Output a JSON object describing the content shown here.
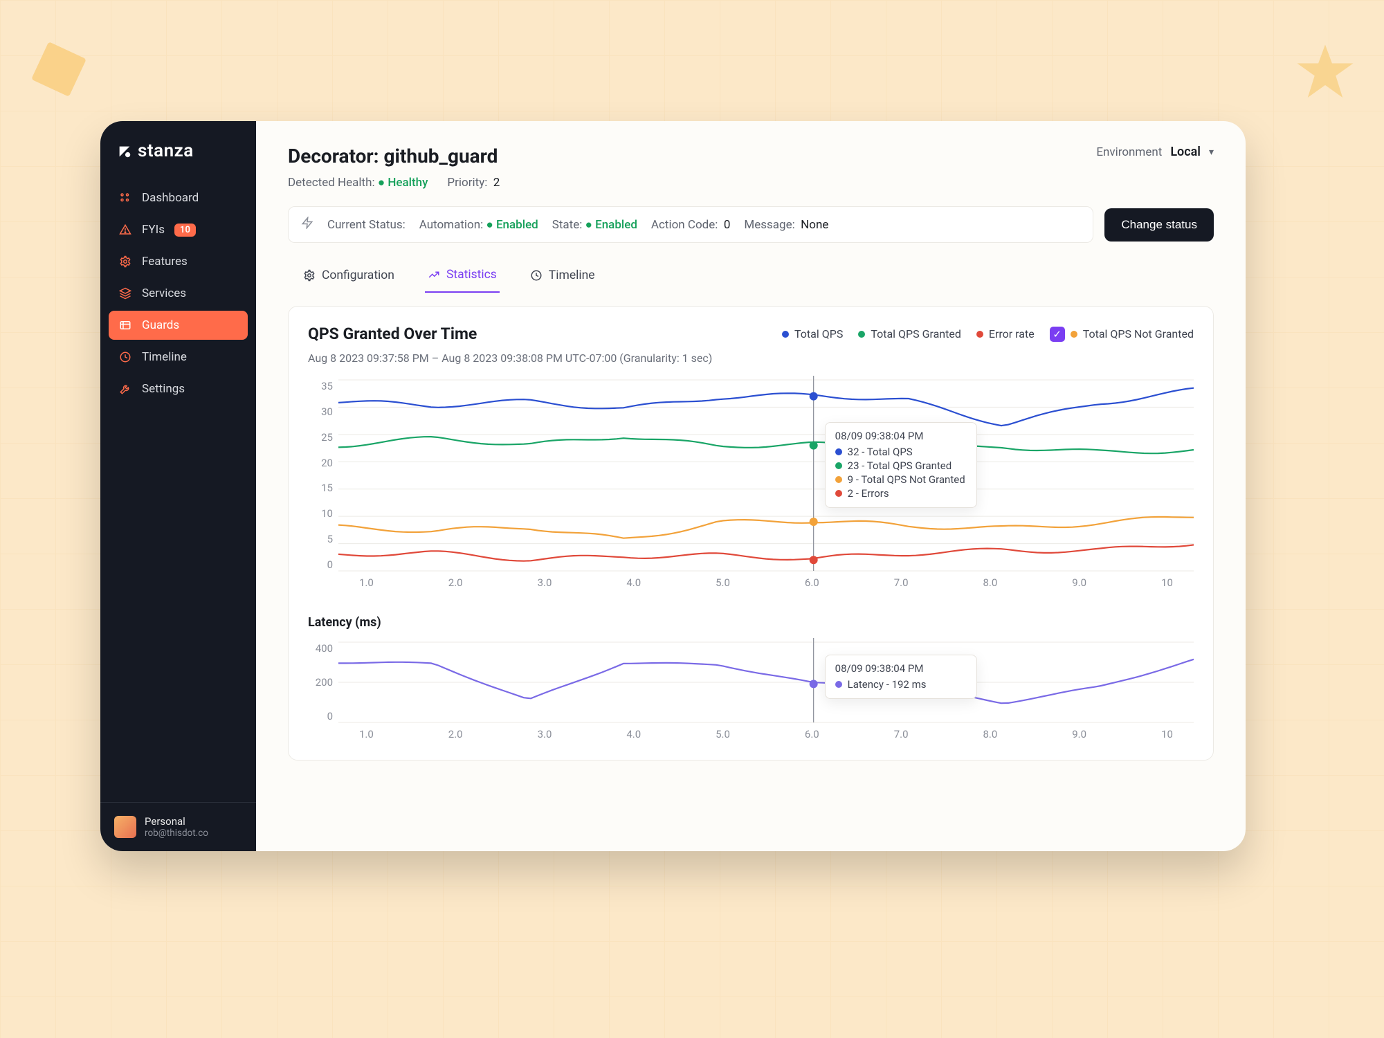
{
  "brand": "stanza",
  "sidebar": {
    "items": [
      {
        "icon": "grid-icon",
        "label": "Dashboard"
      },
      {
        "icon": "alert-icon",
        "label": "FYIs",
        "badge": "10"
      },
      {
        "icon": "gear-icon",
        "label": "Features"
      },
      {
        "icon": "layers-icon",
        "label": "Services"
      },
      {
        "icon": "shield-icon",
        "label": "Guards"
      },
      {
        "icon": "clock-icon",
        "label": "Timeline"
      },
      {
        "icon": "wrench-icon",
        "label": "Settings"
      }
    ],
    "active_index": 4,
    "account": {
      "name": "Personal",
      "email": "rob@thisdot.co"
    }
  },
  "header": {
    "title": "Decorator: github_guard",
    "detected_health_label": "Detected Health:",
    "detected_health_value": "Healthy",
    "priority_label": "Priority:",
    "priority_value": "2",
    "env_label": "Environment",
    "env_value": "Local"
  },
  "status": {
    "current_label": "Current Status:",
    "automation_label": "Automation:",
    "automation_value": "Enabled",
    "state_label": "State:",
    "state_value": "Enabled",
    "action_code_label": "Action Code:",
    "action_code_value": "0",
    "message_label": "Message:",
    "message_value": "None",
    "change_btn": "Change status"
  },
  "tabs": [
    {
      "icon": "gear-icon",
      "label": "Configuration"
    },
    {
      "icon": "trend-icon",
      "label": "Statistics"
    },
    {
      "icon": "clock-icon",
      "label": "Timeline"
    }
  ],
  "tabs_active_index": 1,
  "chart_data": [
    {
      "type": "line",
      "title": "QPS Granted Over Time",
      "timestamp": "Aug 8 2023 09:37:58 PM – Aug 8 2023 09:38:08 PM UTC-07:00 (Granularity: 1 sec)",
      "ylabel": "",
      "xlabel": "",
      "ylim": [
        0,
        35
      ],
      "ytick": [
        0,
        5,
        10,
        15,
        20,
        25,
        30,
        35
      ],
      "xtick": [
        "1.0",
        "2.0",
        "3.0",
        "4.0",
        "5.0",
        "6.0",
        "7.0",
        "8.0",
        "9.0",
        "10"
      ],
      "legend": [
        {
          "name": "Total QPS",
          "color": "#2b4fd1"
        },
        {
          "name": "Total QPS Granted",
          "color": "#1aa567"
        },
        {
          "name": "Error rate",
          "color": "#e0493a"
        },
        {
          "name": "Total QPS Not Granted",
          "color": "#f2a23a",
          "checked": true
        }
      ],
      "x": [
        1,
        2,
        3,
        4,
        5,
        6,
        7,
        8,
        9,
        10
      ],
      "series": [
        {
          "name": "Total QPS",
          "color": "#2b4fd1",
          "values": [
            31,
            30,
            31,
            30,
            32,
            32,
            31,
            27,
            31,
            33
          ]
        },
        {
          "name": "Total QPS Granted",
          "color": "#1aa567",
          "values": [
            23,
            24,
            23,
            25,
            23,
            23,
            22,
            23,
            22,
            22
          ]
        },
        {
          "name": "Total QPS Not Granted",
          "color": "#f2a23a",
          "values": [
            8,
            7,
            8,
            6,
            9,
            9,
            8,
            8,
            9,
            10
          ]
        },
        {
          "name": "Errors",
          "color": "#e0493a",
          "values": [
            3,
            3,
            2,
            3,
            3,
            2,
            3,
            4,
            4,
            5
          ]
        }
      ],
      "cursor": {
        "x": 6,
        "time": "08/09 09:38:04 PM",
        "rows": [
          {
            "color": "#2b4fd1",
            "text": "32 - Total QPS"
          },
          {
            "color": "#1aa567",
            "text": "23 - Total QPS Granted"
          },
          {
            "color": "#f2a23a",
            "text": "9 - Total QPS Not Granted"
          },
          {
            "color": "#e0493a",
            "text": "2 - Errors"
          }
        ]
      }
    },
    {
      "type": "line",
      "title": "Latency (ms)",
      "ylim": [
        0,
        400
      ],
      "ytick": [
        0,
        200,
        400
      ],
      "xtick": [
        "1.0",
        "2.0",
        "3.0",
        "4.0",
        "5.0",
        "6.0",
        "7.0",
        "8.0",
        "9.0",
        "10"
      ],
      "x": [
        1,
        2,
        3,
        4,
        5,
        6,
        7,
        8,
        9,
        10
      ],
      "series": [
        {
          "name": "Latency",
          "color": "#7a6ae6",
          "values": [
            300,
            290,
            110,
            300,
            290,
            192,
            180,
            100,
            180,
            310
          ]
        }
      ],
      "cursor": {
        "x": 6,
        "time": "08/09 09:38:04 PM",
        "rows": [
          {
            "color": "#7a6ae6",
            "text": "Latency - 192 ms"
          }
        ]
      }
    }
  ]
}
